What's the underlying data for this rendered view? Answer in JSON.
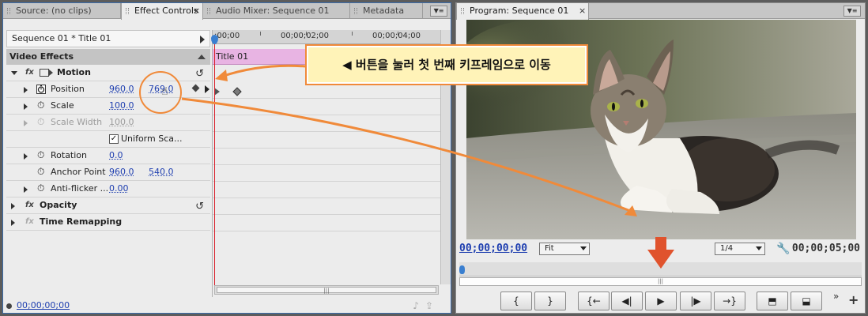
{
  "left_panel": {
    "tabs": [
      {
        "label": "Source: (no clips)"
      },
      {
        "label": "Effect Controls",
        "close": "×"
      },
      {
        "label": "Audio Mixer: Sequence 01"
      },
      {
        "label": "Metadata"
      }
    ],
    "sequence_title": "Sequence 01 * Title 01",
    "video_effects": "Video Effects",
    "motion": {
      "label": "Motion",
      "fx": "fx",
      "props": {
        "position": {
          "label": "Position",
          "x": "960.0",
          "y": "769.0"
        },
        "scale": {
          "label": "Scale",
          "value": "100.0"
        },
        "scale_width": {
          "label": "Scale Width",
          "value": "100.0"
        },
        "uniform_scale": {
          "label": "Uniform Sca...",
          "checked": "✓"
        },
        "rotation": {
          "label": "Rotation",
          "value": "0.0"
        },
        "anchor_point": {
          "label": "Anchor Point",
          "x": "960.0",
          "y": "540.0"
        },
        "anti_flicker": {
          "label": "Anti-flicker ...",
          "value": "0.00"
        }
      }
    },
    "opacity": {
      "label": "Opacity",
      "fx": "fx"
    },
    "time_remapping": {
      "label": "Time Remapping",
      "fx": "fx"
    },
    "ruler": {
      "t0": ";00;00",
      "t1": "00;00;02;00",
      "t2": "00;00;04;00"
    },
    "clip_label": "Title 01",
    "current_time": "00;00;00;00",
    "scroll_grip": "|||"
  },
  "right_panel": {
    "tab": {
      "label": "Program: Sequence 01",
      "close": "×"
    },
    "timecode_current": "00;00;00;00",
    "timecode_duration": "00;00;05;00",
    "zoom": "Fit",
    "resolution": "1/4",
    "scroll_grip": "|||",
    "more": "»",
    "add": "+"
  },
  "annotation": {
    "text": "◀ 버튼을 눌러 첫 번째 키프레임으로 이동"
  },
  "colors": {
    "accent_orange": "#f08a3a",
    "link_blue": "#1f3fb0",
    "playhead_red": "#d9202a",
    "clip_pink": "#e8b4e3",
    "arrow_red": "#e0532d"
  }
}
